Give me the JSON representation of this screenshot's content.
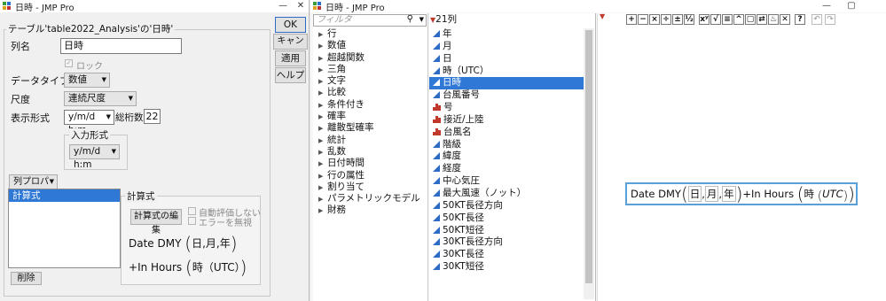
{
  "left_window": {
    "title": "日時 - JMP Pro",
    "header_text": "テーブル'table2022_Analysis'の'日時'",
    "buttons": {
      "ok": "OK",
      "cancel": "キャンセル",
      "apply": "適用",
      "help": "ヘルプ",
      "delete": "削除",
      "edit_formula": "計算式の編集"
    },
    "column_name_label": "列名",
    "column_name_value": "日時",
    "lock_label": "ロック",
    "data_type_label": "データタイプ",
    "data_type_value": "数値",
    "modeling_type_label": "尺度",
    "modeling_type_value": "連続尺度",
    "format_label": "表示形式",
    "format_value": "y/m/d h:m",
    "width_label": "総桁数",
    "width_value": "22",
    "input_format_label": "入力形式",
    "input_format_value": "y/m/d h:m",
    "col_props_button": "列プロパティ",
    "props_list": [
      "計算式"
    ],
    "formula_group_label": "計算式",
    "auto_eval_label": "自動評価しない",
    "ignore_errors_label": "エラーを無視",
    "formula_line1_func": "Date DMY",
    "formula_line1_args": [
      "日",
      "月",
      "年"
    ],
    "formula_line2_prefix": "+",
    "formula_line2_func": "In Hours",
    "formula_line2_arg": "時（UTC）"
  },
  "right_window": {
    "title": "日時 - JMP Pro",
    "filter_placeholder": "フィルタ",
    "column_count": "21列",
    "function_categories": [
      "行",
      "数値",
      "超越関数",
      "三角",
      "文字",
      "比較",
      "条件付き",
      "確率",
      "離散型確率",
      "統計",
      "乱数",
      "日付時間",
      "行の属性",
      "割り当て",
      "パラメトリックモデル",
      "財務"
    ],
    "columns": [
      {
        "name": "年",
        "type": "continuous"
      },
      {
        "name": "月",
        "type": "continuous"
      },
      {
        "name": "日",
        "type": "continuous"
      },
      {
        "name": "時（UTC）",
        "type": "continuous"
      },
      {
        "name": "日時",
        "type": "continuous"
      },
      {
        "name": "台風番号",
        "type": "continuous"
      },
      {
        "name": "号",
        "type": "nominal"
      },
      {
        "name": "接近/上陸",
        "type": "nominal"
      },
      {
        "name": "台風名",
        "type": "nominal"
      },
      {
        "name": "階級",
        "type": "continuous"
      },
      {
        "name": "緯度",
        "type": "continuous"
      },
      {
        "name": "経度",
        "type": "continuous"
      },
      {
        "name": "中心気圧",
        "type": "continuous"
      },
      {
        "name": "最大風速（ノット）",
        "type": "continuous"
      },
      {
        "name": "50KT長径方向",
        "type": "continuous"
      },
      {
        "name": "50KT長径",
        "type": "continuous"
      },
      {
        "name": "50KT短径",
        "type": "continuous"
      },
      {
        "name": "30KT長径方向",
        "type": "continuous"
      },
      {
        "name": "30KT長径",
        "type": "continuous"
      },
      {
        "name": "30KT短径",
        "type": "continuous"
      }
    ],
    "selected_column": "日時",
    "toolbar_icons": [
      "plus-icon",
      "minus-icon",
      "multiply-icon",
      "divide-icon",
      "plus-minus-icon",
      "fraction-icon",
      "power-icon",
      "root-icon",
      "equal-icon",
      "caret-icon",
      "square-icon",
      "swap-icon",
      "fire-icon",
      "delete-icon",
      "help-icon",
      "undo-icon",
      "redo-icon"
    ],
    "toolbar_glyphs": [
      "+",
      "−",
      "×",
      "÷",
      "±",
      "½",
      "xʸ",
      "√",
      "≡",
      "^",
      "▢",
      "⇄",
      "♨",
      "✕",
      "?",
      "↶",
      "↷"
    ],
    "editor_func": "Date DMY",
    "editor_args": [
      "日",
      "月",
      "年"
    ],
    "editor_plus": "+",
    "editor_func2": "In Hours",
    "editor_arg2_a": "時",
    "editor_arg2_b": "UTC"
  }
}
